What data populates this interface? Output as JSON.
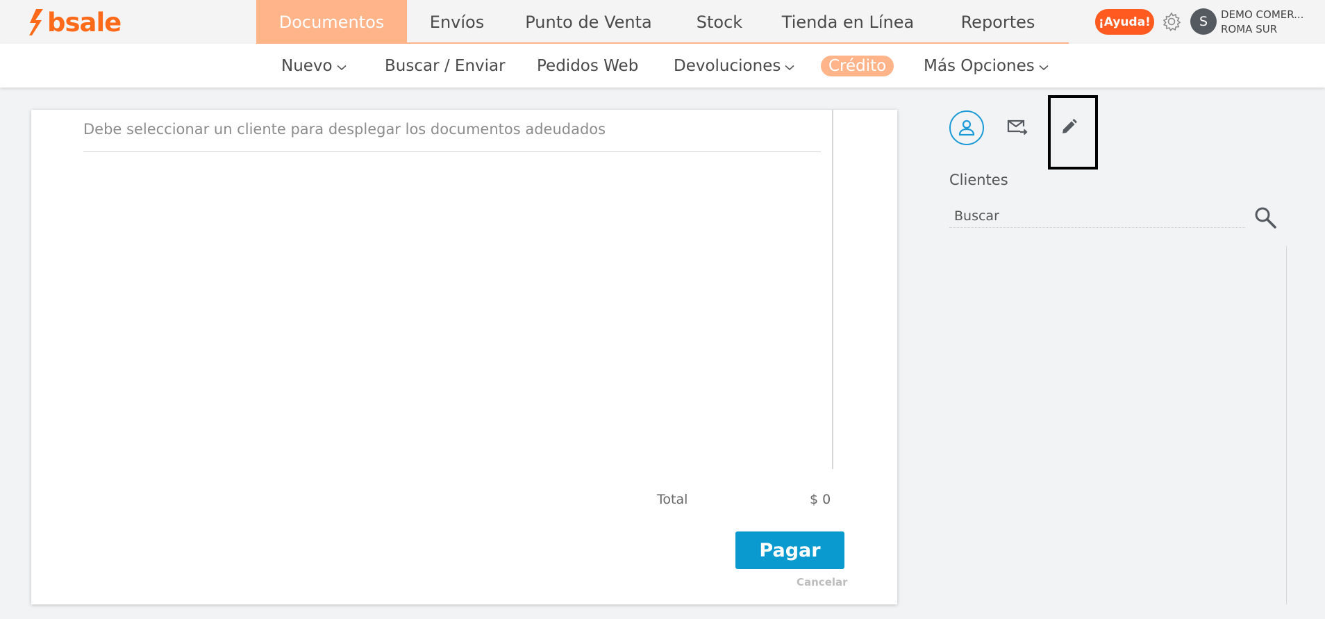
{
  "brand": {
    "name": "bsale",
    "color": "#ff6a1a"
  },
  "main_nav": {
    "tabs": [
      {
        "label": "Documentos",
        "active": true
      },
      {
        "label": "Envíos",
        "active": false
      },
      {
        "label": "Punto de Venta",
        "active": false
      },
      {
        "label": "Stock",
        "active": false
      },
      {
        "label": "Tienda en Línea",
        "active": false
      },
      {
        "label": "Reportes",
        "active": false
      }
    ],
    "active_color": "#ffb48a"
  },
  "header": {
    "help_label": "¡Ayuda!",
    "help_color": "#ff5a1f",
    "settings_icon": "gear-icon",
    "avatar_initial": "S",
    "user_line1": "DEMO COMER...",
    "user_line2": "ROMA SUR"
  },
  "sub_nav": {
    "items": [
      {
        "label": "Nuevo",
        "has_dropdown": true,
        "active": false
      },
      {
        "label": "Buscar / Enviar",
        "has_dropdown": false,
        "active": false
      },
      {
        "label": "Pedidos Web",
        "has_dropdown": false,
        "active": false
      },
      {
        "label": "Devoluciones",
        "has_dropdown": true,
        "active": false
      },
      {
        "label": "Crédito",
        "has_dropdown": false,
        "active": true
      },
      {
        "label": "Más Opciones",
        "has_dropdown": true,
        "active": false
      }
    ]
  },
  "credit_panel": {
    "hint": "Debe seleccionar un cliente para desplegar los documentos adeudados",
    "total_label": "Total",
    "total_value": "$ 0",
    "pay_label": "Pagar",
    "pay_color": "#0b9ad0",
    "cancel_label": "Cancelar"
  },
  "sidebar": {
    "icons": [
      "person-icon",
      "mail-forward-icon",
      "pencil-icon"
    ],
    "selected_icon": "pencil-icon",
    "clients_title": "Clientes",
    "search_placeholder": "Buscar",
    "search_value": "",
    "accent": "#1a9ad6"
  }
}
